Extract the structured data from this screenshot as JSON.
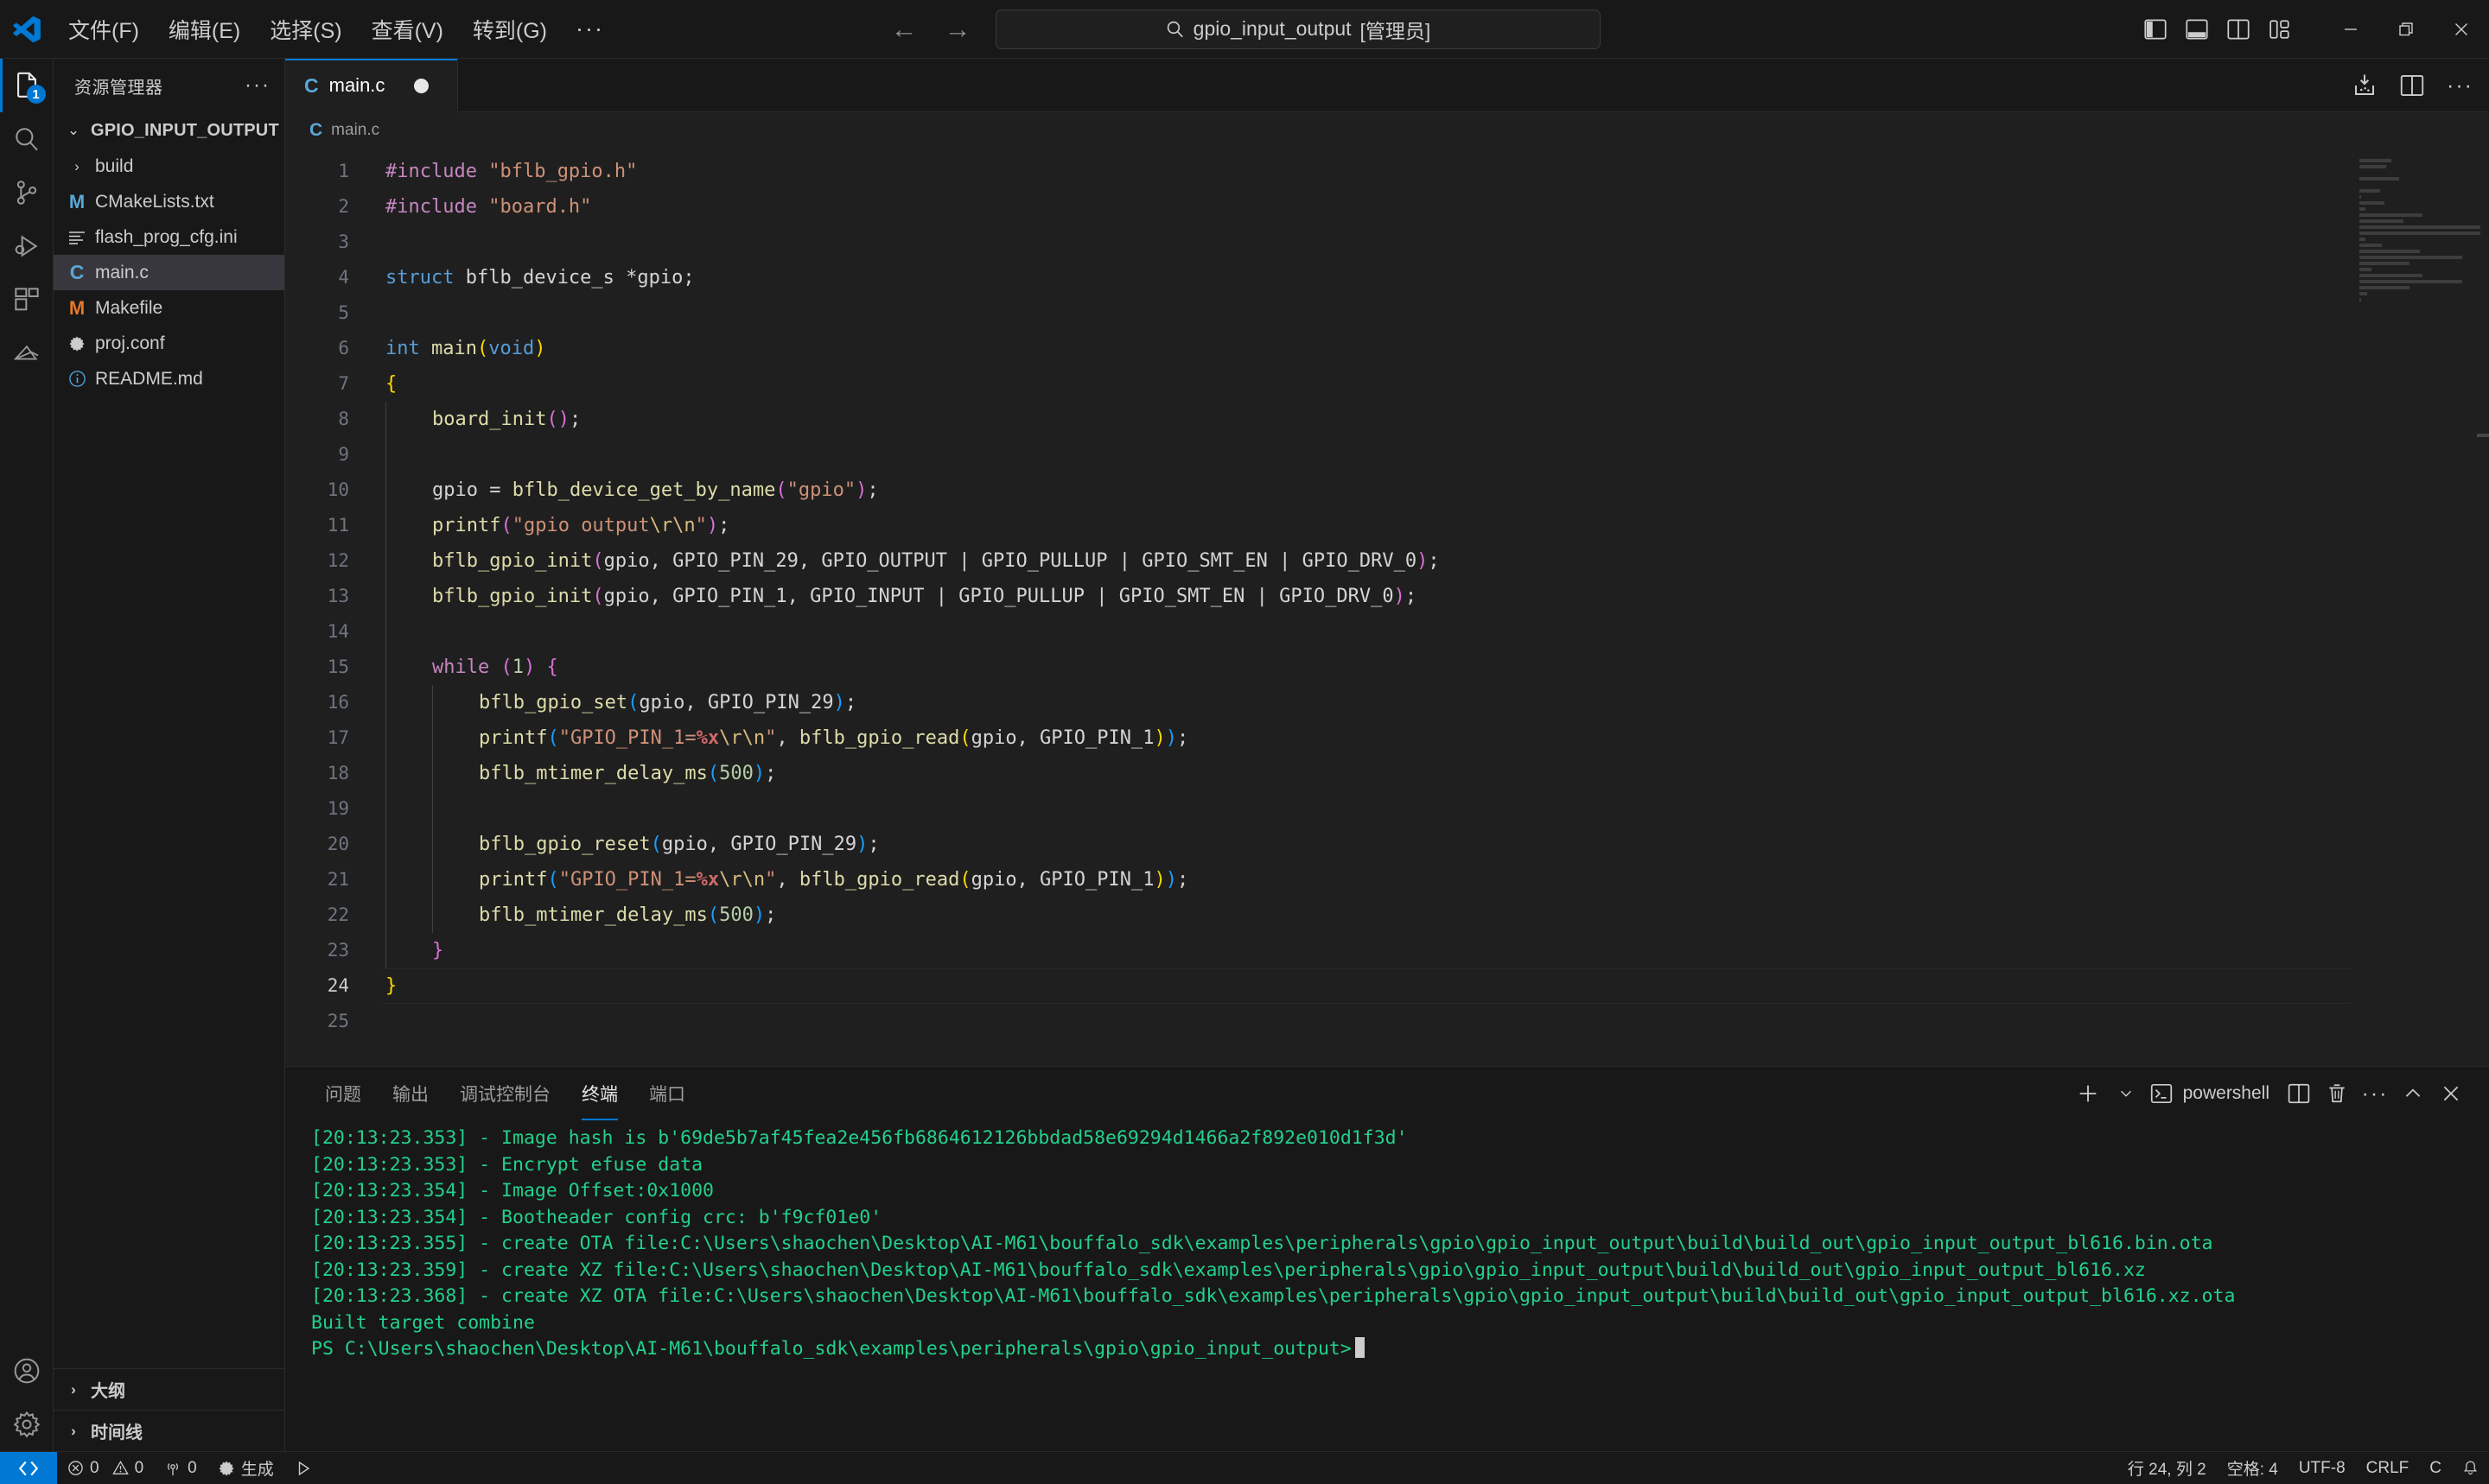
{
  "titlebar": {
    "menu": [
      "文件(F)",
      "编辑(E)",
      "选择(S)",
      "查看(V)",
      "转到(G)"
    ],
    "more_label": "···",
    "back_icon": "←",
    "forward_icon": "→",
    "command_center_text": "gpio_input_output",
    "command_center_suffix": "[管理员]",
    "layout_buttons": [
      "toggle-primary-sidebar",
      "toggle-panel",
      "toggle-secondary-sidebar",
      "customize-layout"
    ],
    "window_controls": [
      "minimize",
      "restore",
      "close"
    ]
  },
  "activitybar": {
    "items": [
      {
        "name": "explorer",
        "badge": "1"
      },
      {
        "name": "search",
        "badge": ""
      },
      {
        "name": "source-control",
        "badge": ""
      },
      {
        "name": "run-and-debug",
        "badge": ""
      },
      {
        "name": "extensions",
        "badge": ""
      },
      {
        "name": "bouffalo-sdk",
        "badge": ""
      }
    ],
    "bottom": [
      {
        "name": "accounts"
      },
      {
        "name": "manage-settings"
      }
    ]
  },
  "sidebar": {
    "title": "资源管理器",
    "more_label": "···",
    "root_folder": "GPIO_INPUT_OUTPUT",
    "files": [
      {
        "label": "build",
        "icon": "folder",
        "selected": false
      },
      {
        "label": "CMakeLists.txt",
        "icon": "cmake",
        "selected": false
      },
      {
        "label": "flash_prog_cfg.ini",
        "icon": "ini",
        "selected": false
      },
      {
        "label": "main.c",
        "icon": "c",
        "selected": true
      },
      {
        "label": "Makefile",
        "icon": "makefile",
        "selected": false
      },
      {
        "label": "proj.conf",
        "icon": "conf",
        "selected": false
      },
      {
        "label": "README.md",
        "icon": "markdown",
        "selected": false
      }
    ],
    "bottom_sections": [
      "大纲",
      "时间线"
    ]
  },
  "editor": {
    "tab": {
      "label": "main.c",
      "dirty": true,
      "icon": "c-file-icon"
    },
    "breadcrumb": "main.c",
    "actions": [
      "flash-download",
      "split-editor",
      "more-actions"
    ],
    "lines": [
      {
        "n": 1,
        "tokens": [
          {
            "t": "#include ",
            "c": "t-pre"
          },
          {
            "t": "\"bflb_gpio.h\"",
            "c": "t-str"
          }
        ]
      },
      {
        "n": 2,
        "tokens": [
          {
            "t": "#include ",
            "c": "t-pre"
          },
          {
            "t": "\"board.h\"",
            "c": "t-str"
          }
        ]
      },
      {
        "n": 3,
        "tokens": []
      },
      {
        "n": 4,
        "tokens": [
          {
            "t": "struct",
            "c": "t-key"
          },
          {
            "t": " bflb_device_s ",
            "c": "t-id"
          },
          {
            "t": "*",
            "c": "t-op"
          },
          {
            "t": "gpio;",
            "c": "t-id"
          }
        ]
      },
      {
        "n": 5,
        "tokens": []
      },
      {
        "n": 6,
        "tokens": [
          {
            "t": "int",
            "c": "t-key"
          },
          {
            "t": " ",
            "c": "t-id"
          },
          {
            "t": "main",
            "c": "t-fn"
          },
          {
            "t": "(",
            "c": "b1"
          },
          {
            "t": "void",
            "c": "t-key"
          },
          {
            "t": ")",
            "c": "b1"
          }
        ]
      },
      {
        "n": 7,
        "tokens": [
          {
            "t": "{",
            "c": "b1"
          }
        ]
      },
      {
        "n": 8,
        "indent": 1,
        "tokens": [
          {
            "t": "board_init",
            "c": "t-fn"
          },
          {
            "t": "(",
            "c": "b2"
          },
          {
            "t": ")",
            "c": "b2"
          },
          {
            "t": ";",
            "c": "t-id"
          }
        ]
      },
      {
        "n": 9,
        "indent": 1,
        "tokens": []
      },
      {
        "n": 10,
        "indent": 1,
        "tokens": [
          {
            "t": "gpio ",
            "c": "t-id"
          },
          {
            "t": "=",
            "c": "t-op"
          },
          {
            "t": " ",
            "c": "t-id"
          },
          {
            "t": "bflb_device_get_by_name",
            "c": "t-fn"
          },
          {
            "t": "(",
            "c": "b2"
          },
          {
            "t": "\"gpio\"",
            "c": "t-str"
          },
          {
            "t": ")",
            "c": "b2"
          },
          {
            "t": ";",
            "c": "t-id"
          }
        ]
      },
      {
        "n": 11,
        "indent": 1,
        "tokens": [
          {
            "t": "printf",
            "c": "t-fn"
          },
          {
            "t": "(",
            "c": "b2"
          },
          {
            "t": "\"gpio output",
            "c": "t-str"
          },
          {
            "t": "\\r\\n",
            "c": "t-esc"
          },
          {
            "t": "\"",
            "c": "t-str"
          },
          {
            "t": ")",
            "c": "b2"
          },
          {
            "t": ";",
            "c": "t-id"
          }
        ]
      },
      {
        "n": 12,
        "indent": 1,
        "tokens": [
          {
            "t": "bflb_gpio_init",
            "c": "t-fn"
          },
          {
            "t": "(",
            "c": "b2"
          },
          {
            "t": "gpio, GPIO_PIN_29, GPIO_OUTPUT ",
            "c": "t-id"
          },
          {
            "t": "|",
            "c": "t-op"
          },
          {
            "t": " GPIO_PULLUP ",
            "c": "t-id"
          },
          {
            "t": "|",
            "c": "t-op"
          },
          {
            "t": " GPIO_SMT_EN ",
            "c": "t-id"
          },
          {
            "t": "|",
            "c": "t-op"
          },
          {
            "t": " GPIO_DRV_0",
            "c": "t-id"
          },
          {
            "t": ")",
            "c": "b2"
          },
          {
            "t": ";",
            "c": "t-id"
          }
        ]
      },
      {
        "n": 13,
        "indent": 1,
        "tokens": [
          {
            "t": "bflb_gpio_init",
            "c": "t-fn"
          },
          {
            "t": "(",
            "c": "b2"
          },
          {
            "t": "gpio, GPIO_PIN_1, GPIO_INPUT ",
            "c": "t-id"
          },
          {
            "t": "|",
            "c": "t-op"
          },
          {
            "t": " GPIO_PULLUP ",
            "c": "t-id"
          },
          {
            "t": "|",
            "c": "t-op"
          },
          {
            "t": " GPIO_SMT_EN ",
            "c": "t-id"
          },
          {
            "t": "|",
            "c": "t-op"
          },
          {
            "t": " GPIO_DRV_0",
            "c": "t-id"
          },
          {
            "t": ")",
            "c": "b2"
          },
          {
            "t": ";",
            "c": "t-id"
          }
        ]
      },
      {
        "n": 14,
        "indent": 1,
        "tokens": []
      },
      {
        "n": 15,
        "indent": 1,
        "tokens": [
          {
            "t": "while",
            "c": "t-ctl"
          },
          {
            "t": " ",
            "c": "t-id"
          },
          {
            "t": "(",
            "c": "b2"
          },
          {
            "t": "1",
            "c": "t-num"
          },
          {
            "t": ")",
            "c": "b2"
          },
          {
            "t": " ",
            "c": "t-id"
          },
          {
            "t": "{",
            "c": "b2"
          }
        ]
      },
      {
        "n": 16,
        "indent": 2,
        "tokens": [
          {
            "t": "bflb_gpio_set",
            "c": "t-fn"
          },
          {
            "t": "(",
            "c": "b3"
          },
          {
            "t": "gpio, GPIO_PIN_29",
            "c": "t-id"
          },
          {
            "t": ")",
            "c": "b3"
          },
          {
            "t": ";",
            "c": "t-id"
          }
        ]
      },
      {
        "n": 17,
        "indent": 2,
        "tokens": [
          {
            "t": "printf",
            "c": "t-fn"
          },
          {
            "t": "(",
            "c": "b3"
          },
          {
            "t": "\"GPIO_PIN_1=",
            "c": "t-str"
          },
          {
            "t": "%x",
            "c": "t-fmt"
          },
          {
            "t": "\\r\\n",
            "c": "t-esc"
          },
          {
            "t": "\"",
            "c": "t-str"
          },
          {
            "t": ", ",
            "c": "t-id"
          },
          {
            "t": "bflb_gpio_read",
            "c": "t-fn"
          },
          {
            "t": "(",
            "c": "b1"
          },
          {
            "t": "gpio, GPIO_PIN_1",
            "c": "t-id"
          },
          {
            "t": ")",
            "c": "b1"
          },
          {
            "t": ")",
            "c": "b3"
          },
          {
            "t": ";",
            "c": "t-id"
          }
        ]
      },
      {
        "n": 18,
        "indent": 2,
        "tokens": [
          {
            "t": "bflb_mtimer_delay_ms",
            "c": "t-fn"
          },
          {
            "t": "(",
            "c": "b3"
          },
          {
            "t": "500",
            "c": "t-num"
          },
          {
            "t": ")",
            "c": "b3"
          },
          {
            "t": ";",
            "c": "t-id"
          }
        ]
      },
      {
        "n": 19,
        "indent": 2,
        "tokens": []
      },
      {
        "n": 20,
        "indent": 2,
        "tokens": [
          {
            "t": "bflb_gpio_reset",
            "c": "t-fn"
          },
          {
            "t": "(",
            "c": "b3"
          },
          {
            "t": "gpio, GPIO_PIN_29",
            "c": "t-id"
          },
          {
            "t": ")",
            "c": "b3"
          },
          {
            "t": ";",
            "c": "t-id"
          }
        ]
      },
      {
        "n": 21,
        "indent": 2,
        "tokens": [
          {
            "t": "printf",
            "c": "t-fn"
          },
          {
            "t": "(",
            "c": "b3"
          },
          {
            "t": "\"GPIO_PIN_1=",
            "c": "t-str"
          },
          {
            "t": "%x",
            "c": "t-fmt"
          },
          {
            "t": "\\r\\n",
            "c": "t-esc"
          },
          {
            "t": "\"",
            "c": "t-str"
          },
          {
            "t": ", ",
            "c": "t-id"
          },
          {
            "t": "bflb_gpio_read",
            "c": "t-fn"
          },
          {
            "t": "(",
            "c": "b1"
          },
          {
            "t": "gpio, GPIO_PIN_1",
            "c": "t-id"
          },
          {
            "t": ")",
            "c": "b1"
          },
          {
            "t": ")",
            "c": "b3"
          },
          {
            "t": ";",
            "c": "t-id"
          }
        ]
      },
      {
        "n": 22,
        "indent": 2,
        "tokens": [
          {
            "t": "bflb_mtimer_delay_ms",
            "c": "t-fn"
          },
          {
            "t": "(",
            "c": "b3"
          },
          {
            "t": "500",
            "c": "t-num"
          },
          {
            "t": ")",
            "c": "b3"
          },
          {
            "t": ";",
            "c": "t-id"
          }
        ]
      },
      {
        "n": 23,
        "indent": 1,
        "tokens": [
          {
            "t": "}",
            "c": "b2"
          }
        ]
      },
      {
        "n": 24,
        "current": true,
        "tokens": [
          {
            "t": "}",
            "c": "b1"
          }
        ]
      },
      {
        "n": 25,
        "tokens": []
      }
    ]
  },
  "panel": {
    "tabs": [
      {
        "label": "问题",
        "active": false
      },
      {
        "label": "输出",
        "active": false
      },
      {
        "label": "调试控制台",
        "active": false
      },
      {
        "label": "终端",
        "active": true
      },
      {
        "label": "端口",
        "active": false
      }
    ],
    "shell_name": "powershell",
    "actions": [
      "new-terminal",
      "new-terminal-dropdown",
      "split-terminal",
      "kill-terminal",
      "more-actions",
      "maximize-panel",
      "close-panel"
    ],
    "terminal_lines": [
      "[20:13:23.353] - Image hash is b'69de5b7af45fea2e456fb6864612126bbdad58e69294d1466a2f892e010d1f3d'",
      "[20:13:23.353] - Encrypt efuse data",
      "[20:13:23.354] - Image Offset:0x1000",
      "[20:13:23.354] - Bootheader config crc: b'f9cf01e0'",
      "[20:13:23.355] - create OTA file:C:\\Users\\shaochen\\Desktop\\AI-M61\\bouffalo_sdk\\examples\\peripherals\\gpio\\gpio_input_output\\build\\build_out\\gpio_input_output_bl616.bin.ota",
      "[20:13:23.359] - create XZ file:C:\\Users\\shaochen\\Desktop\\AI-M61\\bouffalo_sdk\\examples\\peripherals\\gpio\\gpio_input_output\\build\\build_out\\gpio_input_output_bl616.xz",
      "[20:13:23.368] - create XZ OTA file:C:\\Users\\shaochen\\Desktop\\AI-M61\\bouffalo_sdk\\examples\\peripherals\\gpio\\gpio_input_output\\build\\build_out\\gpio_input_output_bl616.xz.ota",
      "Built target combine"
    ],
    "prompt": "PS C:\\Users\\shaochen\\Desktop\\AI-M61\\bouffalo_sdk\\examples\\peripherals\\gpio\\gpio_input_output>"
  },
  "statusbar": {
    "remote_icon": "remote-window-icon",
    "errors": "0",
    "warnings": "0",
    "ports": "0",
    "build_label": "生成",
    "run_icon": "run-icon",
    "position": "行 24, 列 2",
    "indent": "空格: 4",
    "encoding": "UTF-8",
    "eol": "CRLF",
    "language": "C",
    "notifications_icon": "bell-icon"
  },
  "colors": {
    "accent": "#0078d4",
    "terminal_green": "#23d18b",
    "titlebar_bg": "#181818",
    "editor_bg": "#1f1f1f",
    "selection_bg": "#37373d"
  }
}
